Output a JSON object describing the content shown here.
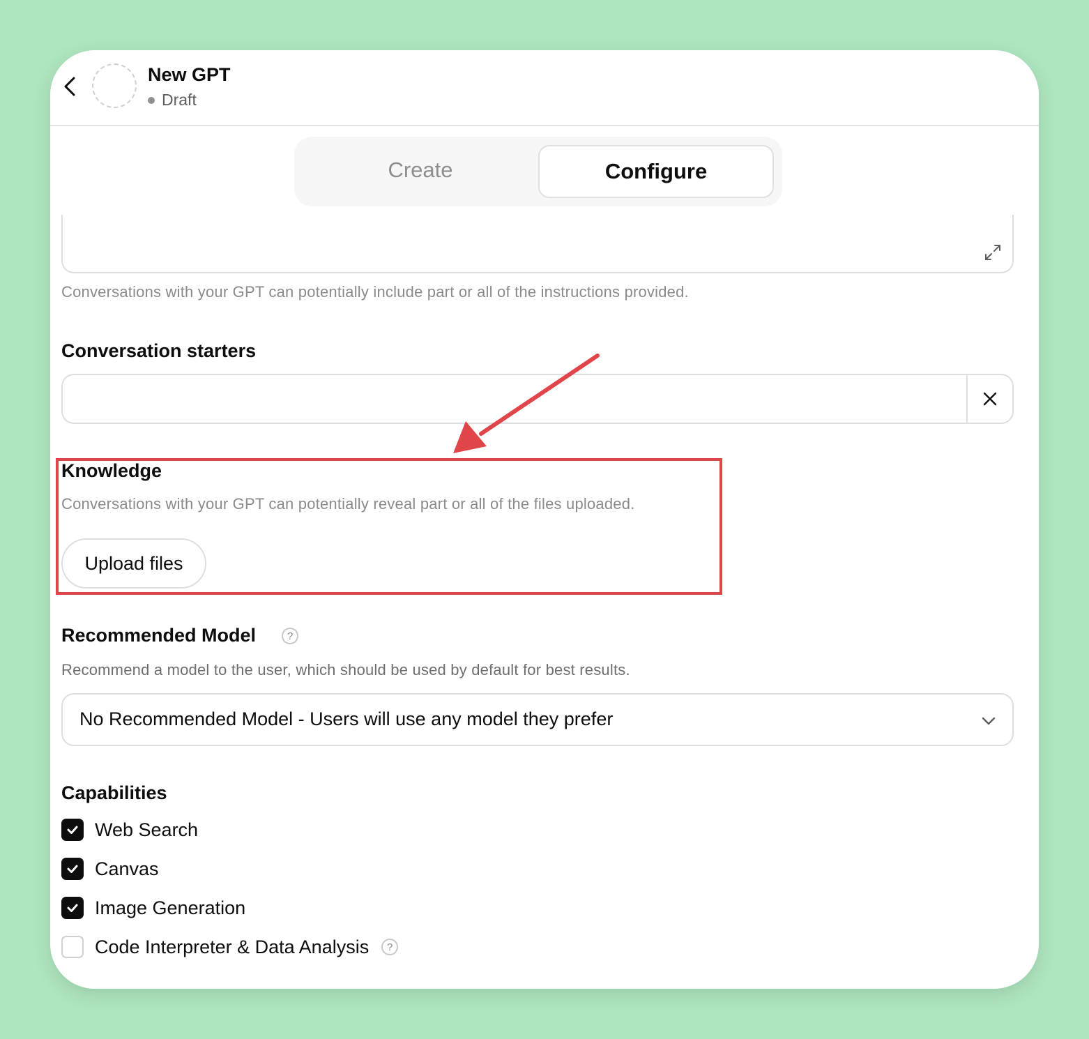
{
  "header": {
    "title": "New GPT",
    "status": "Draft"
  },
  "tabs": [
    {
      "label": "Create",
      "active": false
    },
    {
      "label": "Configure",
      "active": true
    }
  ],
  "instructions": {
    "helper_text": "Conversations with your GPT can potentially include part or all of the instructions provided."
  },
  "conversation_starters": {
    "title": "Conversation starters",
    "value": "",
    "placeholder": ""
  },
  "knowledge": {
    "title": "Knowledge",
    "helper_text": "Conversations with your GPT can potentially reveal part or all of the files uploaded.",
    "upload_label": "Upload files"
  },
  "recommended_model": {
    "title": "Recommended Model",
    "help_glyph": "?",
    "helper_text": "Recommend a model to the user, which should be used by default for best results.",
    "selected": "No Recommended Model - Users will use any model they prefer"
  },
  "capabilities": {
    "title": "Capabilities",
    "items": [
      {
        "label": "Web Search",
        "checked": true
      },
      {
        "label": "Canvas",
        "checked": true
      },
      {
        "label": "Image Generation",
        "checked": true
      },
      {
        "label": "Code Interpreter & Data Analysis",
        "checked": false
      }
    ],
    "help_glyph": "?"
  },
  "colors": {
    "background": "#aee6bf",
    "annotation": "#e0454a",
    "checkbox_checked": "#0d0d0d"
  }
}
